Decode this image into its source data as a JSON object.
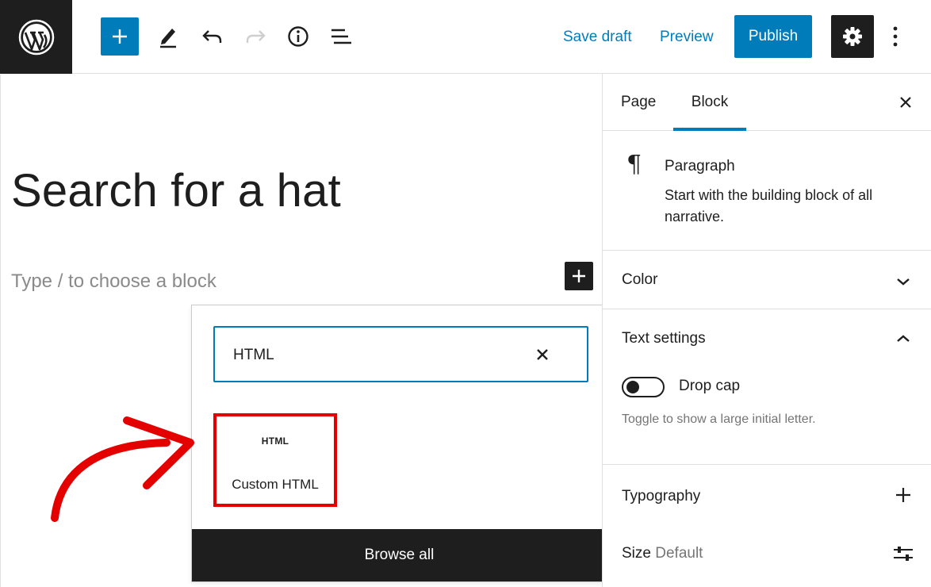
{
  "toolbar": {
    "save_draft_label": "Save draft",
    "preview_label": "Preview",
    "publish_label": "Publish"
  },
  "editor": {
    "post_title": "Search for a hat",
    "block_placeholder": "Type / to choose a block"
  },
  "inserter": {
    "search_value": "HTML",
    "results": [
      {
        "icon_text": "HTML",
        "label": "Custom HTML"
      }
    ],
    "browse_all_label": "Browse all"
  },
  "sidebar": {
    "tabs": [
      {
        "label": "Page",
        "active": false
      },
      {
        "label": "Block",
        "active": true
      }
    ],
    "block_card": {
      "title": "Paragraph",
      "description": "Start with the building block of all narrative."
    },
    "panels": {
      "color": {
        "title": "Color"
      },
      "text_settings": {
        "title": "Text settings",
        "drop_cap_label": "Drop cap",
        "drop_cap_help": "Toggle to show a large initial letter."
      },
      "typography": {
        "title": "Typography",
        "size_label": "Size",
        "size_value": "Default"
      }
    }
  },
  "colors": {
    "accent": "#007cba",
    "dark": "#1e1e1e",
    "highlight": "#e50000"
  }
}
